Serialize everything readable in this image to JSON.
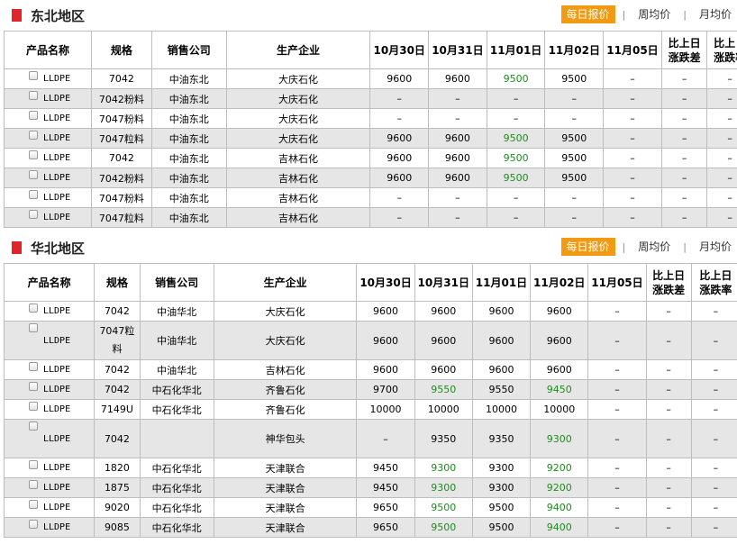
{
  "tabs": {
    "daily": "每日报价",
    "weekly": "周均价",
    "monthly": "月均价",
    "sep": "|"
  },
  "headers": {
    "product": "产品名称",
    "spec": "规格",
    "seller": "销售公司",
    "producer": "生产企业",
    "dates": [
      "10月30日",
      "10月31日",
      "11月01日",
      "11月02日",
      "11月05日"
    ],
    "diff_line1": "比上日",
    "diff_line2": "涨跌差",
    "rate_line1": "比上日",
    "rate_line2": "涨跌率"
  },
  "colors": {
    "accent": "#f39a15",
    "section_bar": "#e0242a",
    "price_change": "#1e8c1e",
    "row_alt": "#e6e6e6"
  },
  "northeast": {
    "title": "东北地区",
    "rows": [
      {
        "product": "LLDPE",
        "spec": "7042",
        "seller": "中油东北",
        "producer": "大庆石化",
        "p": [
          "9600",
          "9600",
          "9500",
          "9500",
          "–"
        ],
        "g": [
          false,
          false,
          true,
          false,
          false
        ],
        "diff": "–",
        "rate": "–"
      },
      {
        "product": "LLDPE",
        "spec": "7042粉料",
        "seller": "中油东北",
        "producer": "大庆石化",
        "p": [
          "–",
          "–",
          "–",
          "–",
          "–"
        ],
        "g": [
          false,
          false,
          false,
          false,
          false
        ],
        "diff": "–",
        "rate": "–"
      },
      {
        "product": "LLDPE",
        "spec": "7047粉料",
        "seller": "中油东北",
        "producer": "大庆石化",
        "p": [
          "–",
          "–",
          "–",
          "–",
          "–"
        ],
        "g": [
          false,
          false,
          false,
          false,
          false
        ],
        "diff": "–",
        "rate": "–"
      },
      {
        "product": "LLDPE",
        "spec": "7047粒料",
        "seller": "中油东北",
        "producer": "大庆石化",
        "p": [
          "9600",
          "9600",
          "9500",
          "9500",
          "–"
        ],
        "g": [
          false,
          false,
          true,
          false,
          false
        ],
        "diff": "–",
        "rate": "–"
      },
      {
        "product": "LLDPE",
        "spec": "7042",
        "seller": "中油东北",
        "producer": "吉林石化",
        "p": [
          "9600",
          "9600",
          "9500",
          "9500",
          "–"
        ],
        "g": [
          false,
          false,
          true,
          false,
          false
        ],
        "diff": "–",
        "rate": "–"
      },
      {
        "product": "LLDPE",
        "spec": "7042粉料",
        "seller": "中油东北",
        "producer": "吉林石化",
        "p": [
          "9600",
          "9600",
          "9500",
          "9500",
          "–"
        ],
        "g": [
          false,
          false,
          true,
          false,
          false
        ],
        "diff": "–",
        "rate": "–"
      },
      {
        "product": "LLDPE",
        "spec": "7047粉料",
        "seller": "中油东北",
        "producer": "吉林石化",
        "p": [
          "–",
          "–",
          "–",
          "–",
          "–"
        ],
        "g": [
          false,
          false,
          false,
          false,
          false
        ],
        "diff": "–",
        "rate": "–"
      },
      {
        "product": "LLDPE",
        "spec": "7047粒料",
        "seller": "中油东北",
        "producer": "吉林石化",
        "p": [
          "–",
          "–",
          "–",
          "–",
          "–"
        ],
        "g": [
          false,
          false,
          false,
          false,
          false
        ],
        "diff": "–",
        "rate": "–"
      }
    ]
  },
  "north": {
    "title": "华北地区",
    "rows": [
      {
        "product": "LLDPE",
        "spec": "7042",
        "seller": "中油华北",
        "producer": "大庆石化",
        "p": [
          "9600",
          "9600",
          "9600",
          "9600",
          "–"
        ],
        "g": [
          false,
          false,
          false,
          false,
          false
        ],
        "diff": "–",
        "rate": "–"
      },
      {
        "product": "LLDPE",
        "spec": "7047粒料",
        "seller": "中油华北",
        "producer": "大庆石化",
        "p": [
          "9600",
          "9600",
          "9600",
          "9600",
          "–"
        ],
        "g": [
          false,
          false,
          false,
          false,
          false
        ],
        "diff": "–",
        "rate": "–"
      },
      {
        "product": "LLDPE",
        "spec": "7042",
        "seller": "中油华北",
        "producer": "吉林石化",
        "p": [
          "9600",
          "9600",
          "9600",
          "9600",
          "–"
        ],
        "g": [
          false,
          false,
          false,
          false,
          false
        ],
        "diff": "–",
        "rate": "–"
      },
      {
        "product": "LLDPE",
        "spec": "7042",
        "seller": "中石化华北",
        "producer": "齐鲁石化",
        "p": [
          "9700",
          "9550",
          "9550",
          "9450",
          "–"
        ],
        "g": [
          false,
          true,
          false,
          true,
          false
        ],
        "diff": "–",
        "rate": "–"
      },
      {
        "product": "LLDPE",
        "spec": "7149U",
        "seller": "中石化华北",
        "producer": "齐鲁石化",
        "p": [
          "10000",
          "10000",
          "10000",
          "10000",
          "–"
        ],
        "g": [
          false,
          false,
          false,
          false,
          false
        ],
        "diff": "–",
        "rate": "–"
      },
      {
        "product": "LLDPE",
        "spec": "7042",
        "seller": "",
        "producer": "神华包头",
        "p": [
          "–",
          "9350",
          "9350",
          "9300",
          "–"
        ],
        "g": [
          false,
          false,
          false,
          true,
          false
        ],
        "diff": "–",
        "rate": "–"
      },
      {
        "product": "LLDPE",
        "spec": "1820",
        "seller": "中石化华北",
        "producer": "天津联合",
        "p": [
          "9450",
          "9300",
          "9300",
          "9200",
          "–"
        ],
        "g": [
          false,
          true,
          false,
          true,
          false
        ],
        "diff": "–",
        "rate": "–"
      },
      {
        "product": "LLDPE",
        "spec": "1875",
        "seller": "中石化华北",
        "producer": "天津联合",
        "p": [
          "9450",
          "9300",
          "9300",
          "9200",
          "–"
        ],
        "g": [
          false,
          true,
          false,
          true,
          false
        ],
        "diff": "–",
        "rate": "–"
      },
      {
        "product": "LLDPE",
        "spec": "9020",
        "seller": "中石化华北",
        "producer": "天津联合",
        "p": [
          "9650",
          "9500",
          "9500",
          "9400",
          "–"
        ],
        "g": [
          false,
          true,
          false,
          true,
          false
        ],
        "diff": "–",
        "rate": "–"
      },
      {
        "product": "LLDPE",
        "spec": "9085",
        "seller": "中石化华北",
        "producer": "天津联合",
        "p": [
          "9650",
          "9500",
          "9500",
          "9400",
          "–"
        ],
        "g": [
          false,
          true,
          false,
          true,
          false
        ],
        "diff": "–",
        "rate": "–"
      }
    ]
  }
}
